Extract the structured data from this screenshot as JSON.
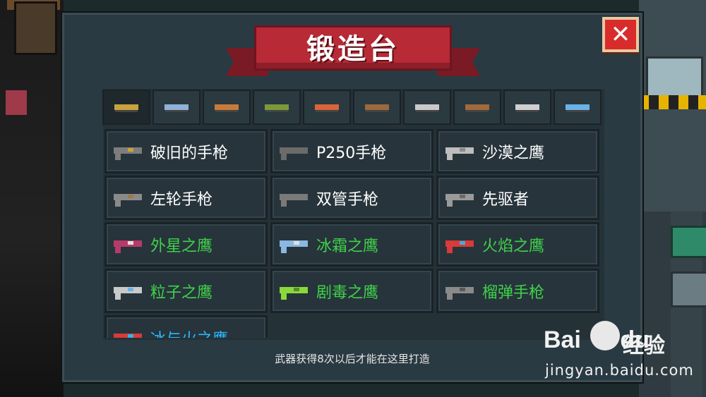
{
  "title": "锻造台",
  "close_label": "✕",
  "tabs": [
    {
      "icon": "pistol-icon",
      "active": true,
      "color": "#c9a23a"
    },
    {
      "icon": "rifle-icon",
      "active": false,
      "color": "#8fb2d9"
    },
    {
      "icon": "shotgun-icon",
      "active": false,
      "color": "#c77a3a"
    },
    {
      "icon": "rocket-launcher-icon",
      "active": false,
      "color": "#7a9a3a"
    },
    {
      "icon": "blaster-icon",
      "active": false,
      "color": "#d9643a"
    },
    {
      "icon": "bow-icon",
      "active": false,
      "color": "#9a6a3a"
    },
    {
      "icon": "sword-icon",
      "active": false,
      "color": "#c9c9c9"
    },
    {
      "icon": "spear-icon",
      "active": false,
      "color": "#a06a3a"
    },
    {
      "icon": "shuriken-icon",
      "active": false,
      "color": "#cfcfcf"
    },
    {
      "icon": "fish-icon",
      "active": false,
      "color": "#6ab2e6"
    }
  ],
  "weapons": [
    {
      "name": "破旧的手枪",
      "rarity": "white",
      "gun_color": "#7d7d7d",
      "accent": "#c9a23a"
    },
    {
      "name": "P250手枪",
      "rarity": "white",
      "gun_color": "#6b6b6b",
      "accent": "#6b6b6b"
    },
    {
      "name": "沙漠之鹰",
      "rarity": "white",
      "gun_color": "#bdbdbd",
      "accent": "#8a8a8a"
    },
    {
      "name": "左轮手枪",
      "rarity": "white",
      "gun_color": "#8a8a8a",
      "accent": "#a0764a"
    },
    {
      "name": "双管手枪",
      "rarity": "white",
      "gun_color": "#7a7a7a",
      "accent": "#7a7a7a"
    },
    {
      "name": "先驱者",
      "rarity": "white",
      "gun_color": "#9a9a9a",
      "accent": "#6a6a6a"
    },
    {
      "name": "外星之鹰",
      "rarity": "green",
      "gun_color": "#b83a6a",
      "accent": "#e0e0e0"
    },
    {
      "name": "冰霜之鹰",
      "rarity": "green",
      "gun_color": "#8ab8e0",
      "accent": "#e0e0e0"
    },
    {
      "name": "火焰之鹰",
      "rarity": "green",
      "gun_color": "#d93a3a",
      "accent": "#3ab0e0"
    },
    {
      "name": "粒子之鹰",
      "rarity": "green",
      "gun_color": "#c9c9c9",
      "accent": "#6ab2e6"
    },
    {
      "name": "剧毒之鹰",
      "rarity": "green",
      "gun_color": "#8ad93a",
      "accent": "#5a8a2a"
    },
    {
      "name": "榴弹手枪",
      "rarity": "green",
      "gun_color": "#8a8a8a",
      "accent": "#5a5a5a"
    },
    {
      "name": "冰与火之鹰",
      "rarity": "blue",
      "gun_color": "#d93a3a",
      "accent": "#3ab0e0"
    }
  ],
  "footer": "武器获得8次以后才能在这里打造",
  "watermark": {
    "brand": "Bai",
    "brand2": "du",
    "cn": "经验",
    "url": "jingyan.baidu.com"
  }
}
